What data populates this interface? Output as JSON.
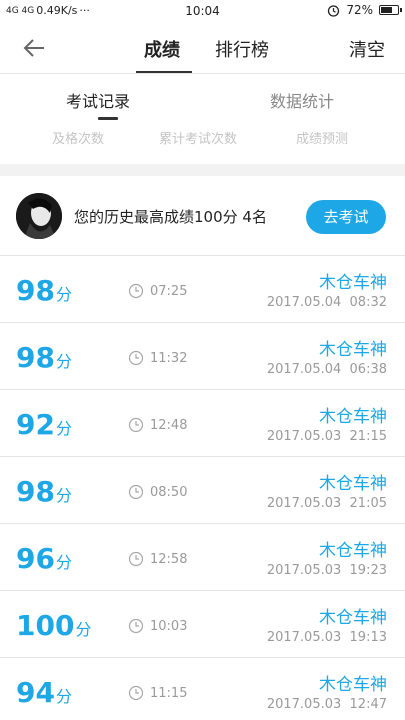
{
  "status_bar": {
    "network": "4G 4G",
    "speed": "0.49K/s",
    "dots": "···",
    "time": "10:04",
    "battery": "72%",
    "battery_level": 0.72,
    "alarm_icon": "alarm-clock-icon"
  },
  "nav": {
    "back_icon": "back-arrow-icon",
    "tab_score": "成绩",
    "tab_rank": "排行榜",
    "clear": "清空"
  },
  "subtabs": {
    "records": "考试记录",
    "stats": "数据统计"
  },
  "stats_labels": [
    "及格次数",
    "累计考试次数",
    "成绩预测"
  ],
  "summary": {
    "text": "您的历史最高成绩100分  4名",
    "button": "去考试"
  },
  "accent_color": "#1da7e6",
  "records": [
    {
      "score": "98",
      "unit": "分",
      "duration": "07:25",
      "name": "木仓车神",
      "datetime": "2017.05.04  08:32"
    },
    {
      "score": "98",
      "unit": "分",
      "duration": "11:32",
      "name": "木仓车神",
      "datetime": "2017.05.04  06:38"
    },
    {
      "score": "92",
      "unit": "分",
      "duration": "12:48",
      "name": "木仓车神",
      "datetime": "2017.05.03  21:15"
    },
    {
      "score": "98",
      "unit": "分",
      "duration": "08:50",
      "name": "木仓车神",
      "datetime": "2017.05.03  21:05"
    },
    {
      "score": "96",
      "unit": "分",
      "duration": "12:58",
      "name": "木仓车神",
      "datetime": "2017.05.03  19:23"
    },
    {
      "score": "100",
      "unit": "分",
      "duration": "10:03",
      "name": "木仓车神",
      "datetime": "2017.05.03  19:13"
    },
    {
      "score": "94",
      "unit": "分",
      "duration": "11:15",
      "name": "木仓车神",
      "datetime": "2017.05.03  12:47"
    }
  ]
}
